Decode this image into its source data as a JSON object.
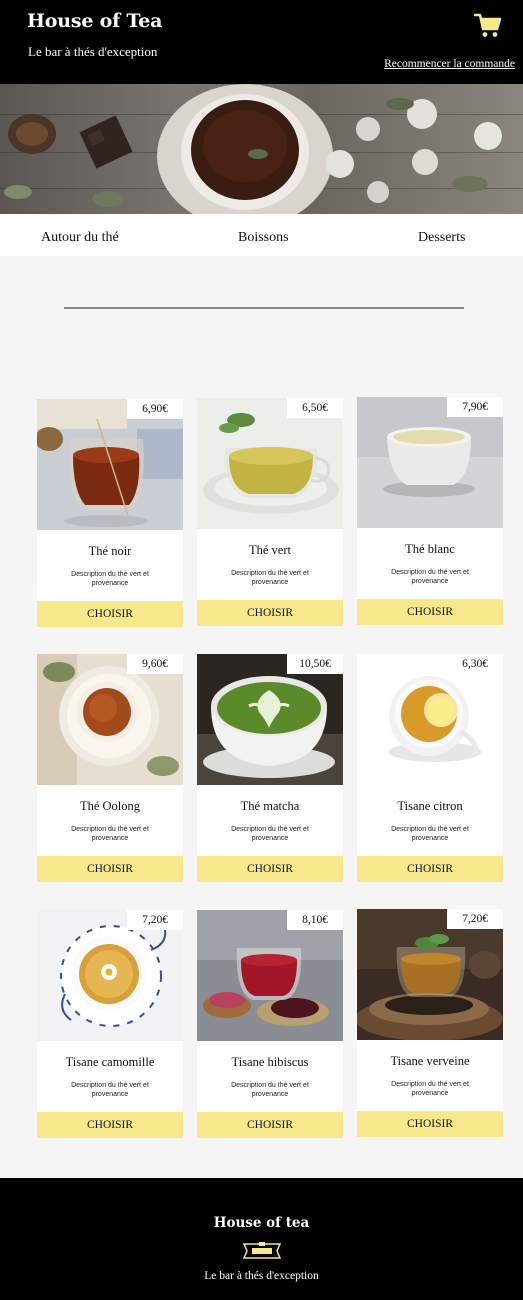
{
  "header": {
    "brand": "House of Tea",
    "tagline": "Le bar à thés d'exception",
    "restart_label": "Recommencer la commande",
    "cart_icon": "shopping-cart-icon",
    "accent_color": "#f7e98b"
  },
  "nav": {
    "items": [
      {
        "label": "Autour du thé"
      },
      {
        "label": "Boissons"
      },
      {
        "label": "Desserts"
      }
    ]
  },
  "products": [
    {
      "name": "Thé noir",
      "price": "6,90€",
      "description": "Description du thé vert et provenance",
      "button": "CHOISIR"
    },
    {
      "name": "Thé vert",
      "price": "6,50€",
      "description": "Description du thé vert et provenance",
      "button": "CHOISIR"
    },
    {
      "name": "Thé blanc",
      "price": "7,90€",
      "description": "Description du thé vert et provenance",
      "button": "CHOISIR"
    },
    {
      "name": "Thé Oolong",
      "price": "9,60€",
      "description": "Description du thé vert et provenance",
      "button": "CHOISIR"
    },
    {
      "name": "Thé matcha",
      "price": "10,50€",
      "description": "Description du thé vert et provenance",
      "button": "CHOISIR"
    },
    {
      "name": "Tisane citron",
      "price": "6,30€",
      "description": "Description du thé vert et provenance",
      "button": "CHOISIR"
    },
    {
      "name": "Tisane camomille",
      "price": "7,20€",
      "description": "Description du thé vert et provenance",
      "button": "CHOISIR"
    },
    {
      "name": "Tisane hibiscus",
      "price": "8,10€",
      "description": "Description du thé vert et provenance",
      "button": "CHOISIR"
    },
    {
      "name": "Tisane verveine",
      "price": "7,20€",
      "description": "Description du thé vert et provenance",
      "button": "CHOISIR"
    }
  ],
  "footer": {
    "brand": "House of tea",
    "tagline": "Le bar à thés d'exception"
  }
}
